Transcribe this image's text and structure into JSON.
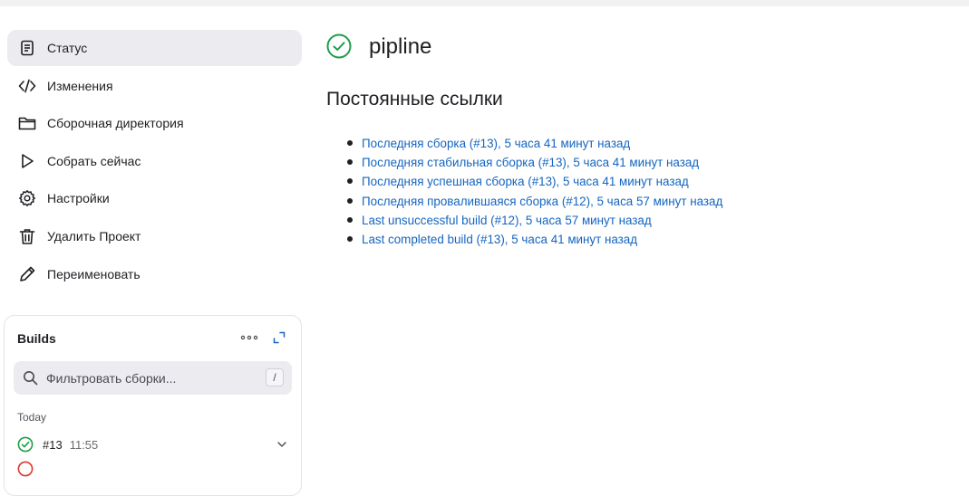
{
  "nav": {
    "items": [
      {
        "label": "Статус",
        "icon": "document-icon"
      },
      {
        "label": "Изменения",
        "icon": "code-icon"
      },
      {
        "label": "Сборочная директория",
        "icon": "folder-icon"
      },
      {
        "label": "Собрать сейчас",
        "icon": "play-icon"
      },
      {
        "label": "Настройки",
        "icon": "gear-icon"
      },
      {
        "label": "Удалить Проект",
        "icon": "trash-icon"
      },
      {
        "label": "Переименовать",
        "icon": "pencil-icon"
      }
    ]
  },
  "builds": {
    "title": "Builds",
    "search_placeholder": "Фильтровать сборки...",
    "shortcut": "/",
    "group_label": "Today",
    "rows": [
      {
        "number": "#13",
        "time": "11:55",
        "status": "success"
      }
    ]
  },
  "main": {
    "title": "pipline",
    "section_title": "Постоянные ссылки",
    "links": [
      "Последняя сборка (#13), 5 часа 41 минут назад",
      "Последняя стабильная сборка (#13), 5 часа 41 минут назад",
      "Последняя успешная сборка (#13), 5 часа 41 минут назад",
      "Последняя провалившаяся сборка (#12), 5 часа 57 минут назад",
      "Last unsuccessful build (#12), 5 часа 57 минут назад",
      "Last completed build (#13), 5 часа 41 минут назад"
    ]
  },
  "colors": {
    "success": "#1e9e4a",
    "failure": "#e0342c",
    "link": "#1565c0",
    "active_bg": "#ececf0"
  }
}
